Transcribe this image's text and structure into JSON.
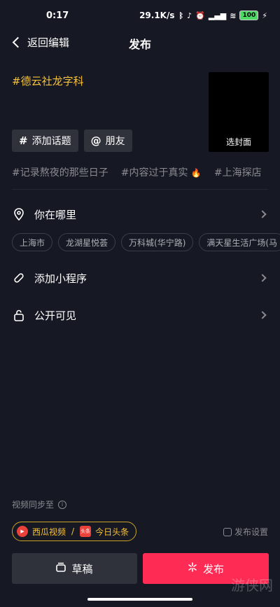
{
  "status_bar": {
    "time": "0:17",
    "net_speed": "29.1K/s",
    "battery": "100"
  },
  "nav": {
    "back_label": "返回编辑",
    "title": "发布"
  },
  "caption": "#德云社龙字科",
  "cover_label": "选封面",
  "chips": {
    "topic_label": "添加话题",
    "friend_label": "朋友"
  },
  "suggested_tags": [
    "#记录熬夜的那些日子",
    "#内容过于真实",
    "#上海探店"
  ],
  "location": {
    "label": "你在哪里",
    "chips": [
      "上海市",
      "龙湖星悦荟",
      "万科城(华宁路)",
      "满天星生活广场(马"
    ]
  },
  "mini_program_label": "添加小程序",
  "visibility_label": "公开可见",
  "sync": {
    "label": "视频同步至",
    "app1": "西瓜视频",
    "separator": "/",
    "app2": "今日头条",
    "app2_logo": "头条",
    "settings_label": "发布设置"
  },
  "actions": {
    "draft_label": "草稿",
    "publish_label": "发布"
  },
  "watermark": "游侠网",
  "colors": {
    "background": "#161823",
    "accent_yellow": "#f7c23b",
    "publish_red": "#fe2c55"
  }
}
